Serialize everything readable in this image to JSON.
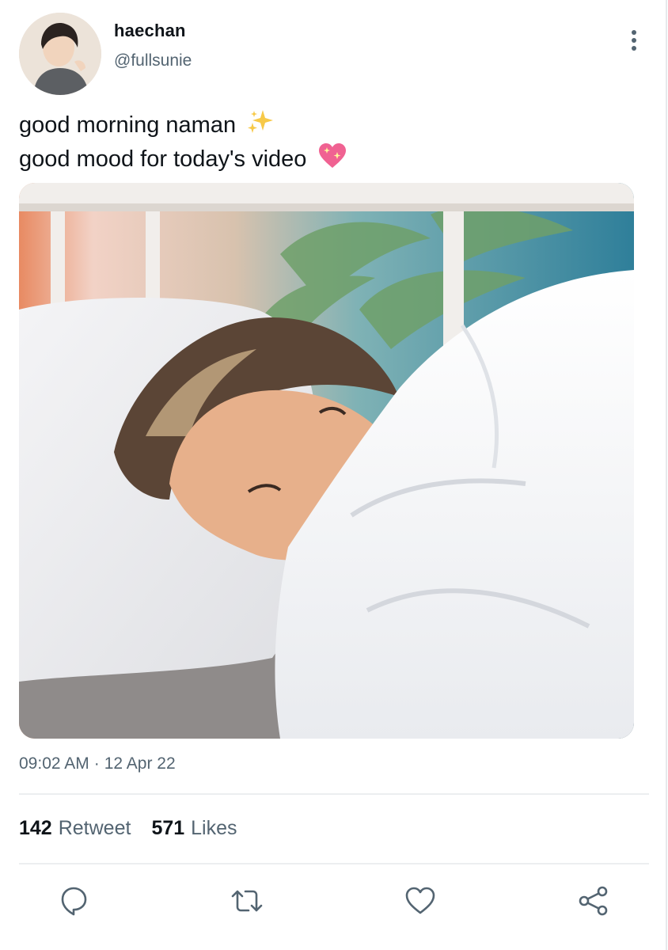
{
  "author": {
    "display_name": "haechan",
    "handle": "@fullsunie"
  },
  "tweet": {
    "line1": "good morning naman",
    "line1_emoji": "sparkles",
    "line2": "good mood for today's video",
    "line2_emoji": "sparkling-heart",
    "time": "09:02 AM",
    "separator": "·",
    "date": "12 Apr 22"
  },
  "stats": {
    "retweets_count": "142",
    "retweets_label": "Retweet",
    "likes_count": "571",
    "likes_label": "Likes"
  },
  "actions": [
    "reply-icon",
    "retweet-icon",
    "like-icon",
    "share-icon"
  ],
  "colors": {
    "text": "#0f1419",
    "secondary": "#536471",
    "divider": "#eceef0",
    "heart": "#f06292",
    "sparkle": "#f7c948"
  }
}
